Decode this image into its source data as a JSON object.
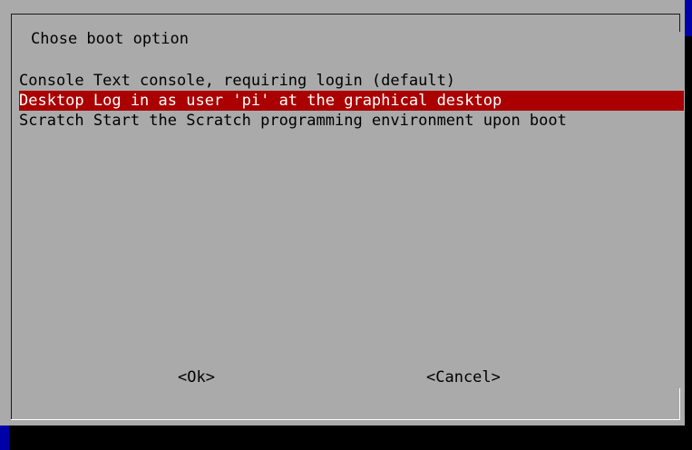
{
  "dialog": {
    "title": "Chose boot option"
  },
  "menu": {
    "items": [
      {
        "label": "Console Text console, requiring login (default)",
        "selected": false
      },
      {
        "label": "Desktop Log in as user 'pi' at the graphical desktop",
        "selected": true
      },
      {
        "label": "Scratch Start the Scratch programming environment upon boot",
        "selected": false
      }
    ]
  },
  "buttons": {
    "ok_label": "<Ok>",
    "cancel_label": "<Cancel>"
  },
  "colors": {
    "background": "#0000a8",
    "dialog": "#aaaaaa",
    "selection": "#aa0000",
    "selection_text": "#ffffff"
  }
}
